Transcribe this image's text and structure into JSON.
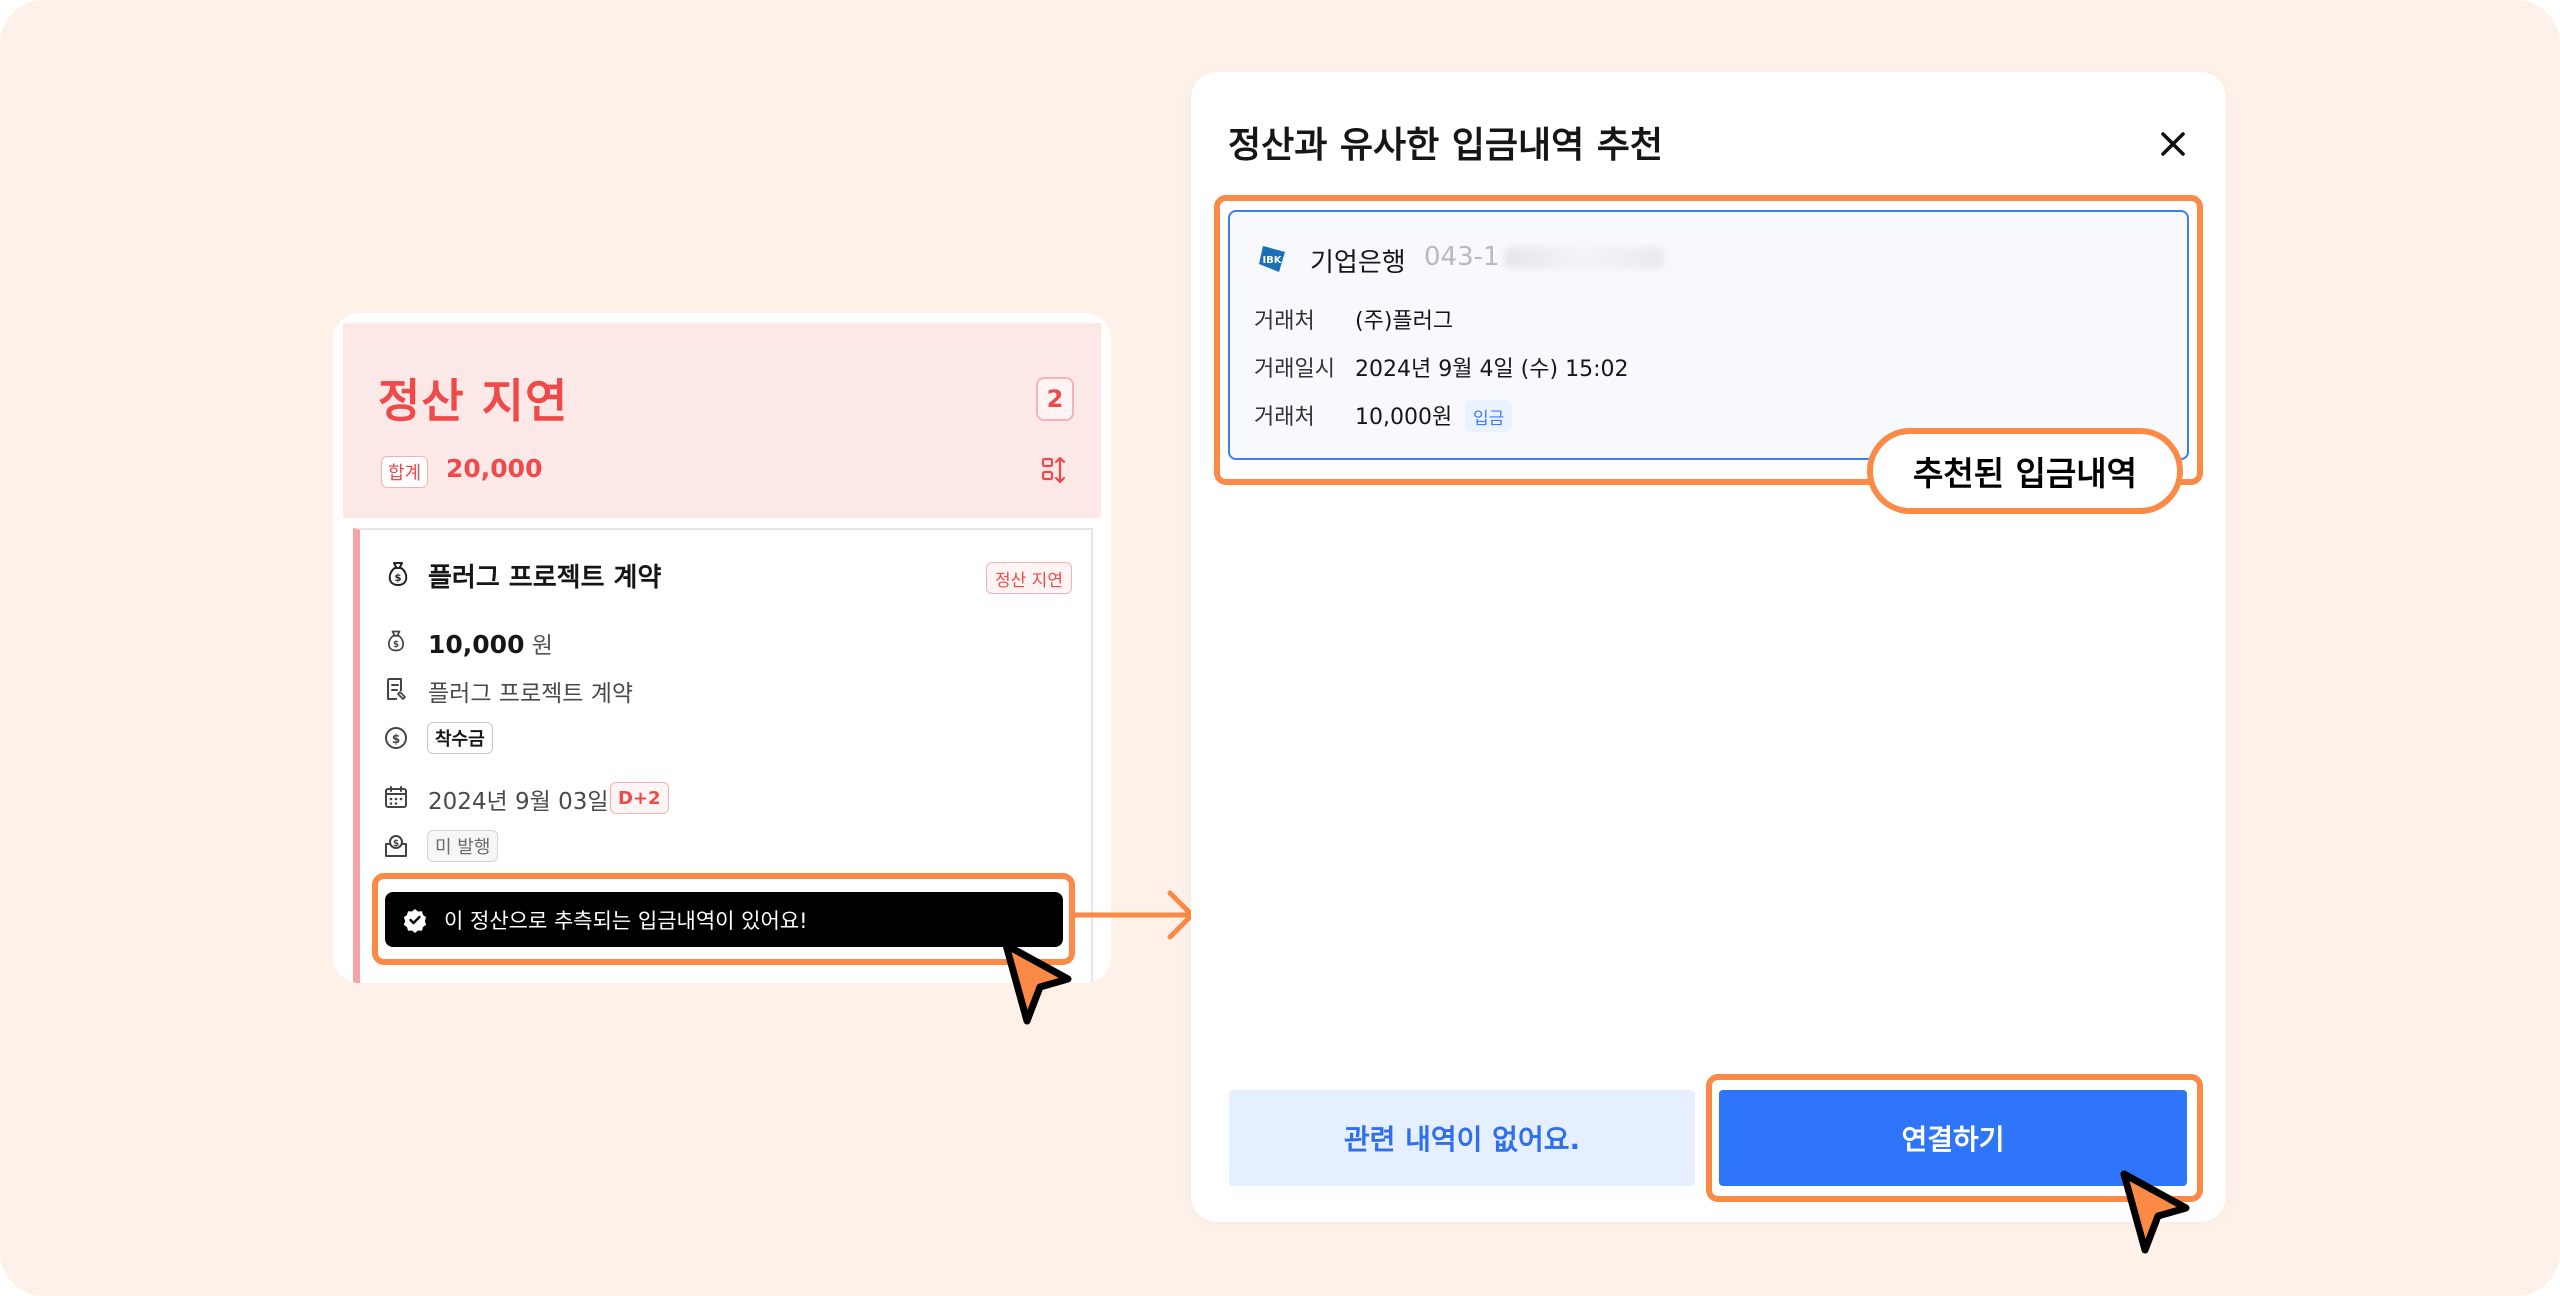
{
  "settlement_card": {
    "title": "정산 지연",
    "count": "2",
    "sum_label": "합계",
    "sum_value": "20,000",
    "item": {
      "title": "플러그 프로젝트 계약",
      "status": "정산 지연",
      "amount": "10,000",
      "unit": "원",
      "contract": "플러그 프로젝트 계약",
      "payment_type": "착수금",
      "date": "2024년 9월 03일",
      "dday": "D+2",
      "invoice_status": "미 발행"
    },
    "notice": "이 정산으로 추측되는 입금내역이 있어요!"
  },
  "modal": {
    "title": "정산과 유사한 입금내역 추천",
    "recommendation": {
      "bank_name": "기업은행",
      "account_prefix": "043-1",
      "rows": [
        {
          "label": "거래처",
          "value": "(주)플러그"
        },
        {
          "label": "거래일시",
          "value": "2024년 9월 4일 (수) 15:02"
        },
        {
          "label": "거래처",
          "value": "10,000원"
        }
      ],
      "deposit_tag": "입금"
    },
    "callout": "추천된 입금내역",
    "buttons": {
      "none": "관련 내역이 없어요.",
      "link": "연결하기"
    }
  },
  "colors": {
    "background": "#fdf1ea",
    "highlight": "#fb8a46",
    "danger": "#ee4a4a",
    "primary": "#2f75fa"
  },
  "icons": [
    "money-bag-icon",
    "document-icon",
    "dollar-circle-icon",
    "calendar-icon",
    "receipt-icon",
    "check-circle-icon",
    "sort-icon",
    "close-icon",
    "bank-logo-icon",
    "cursor-icon",
    "arrow-right-icon"
  ]
}
